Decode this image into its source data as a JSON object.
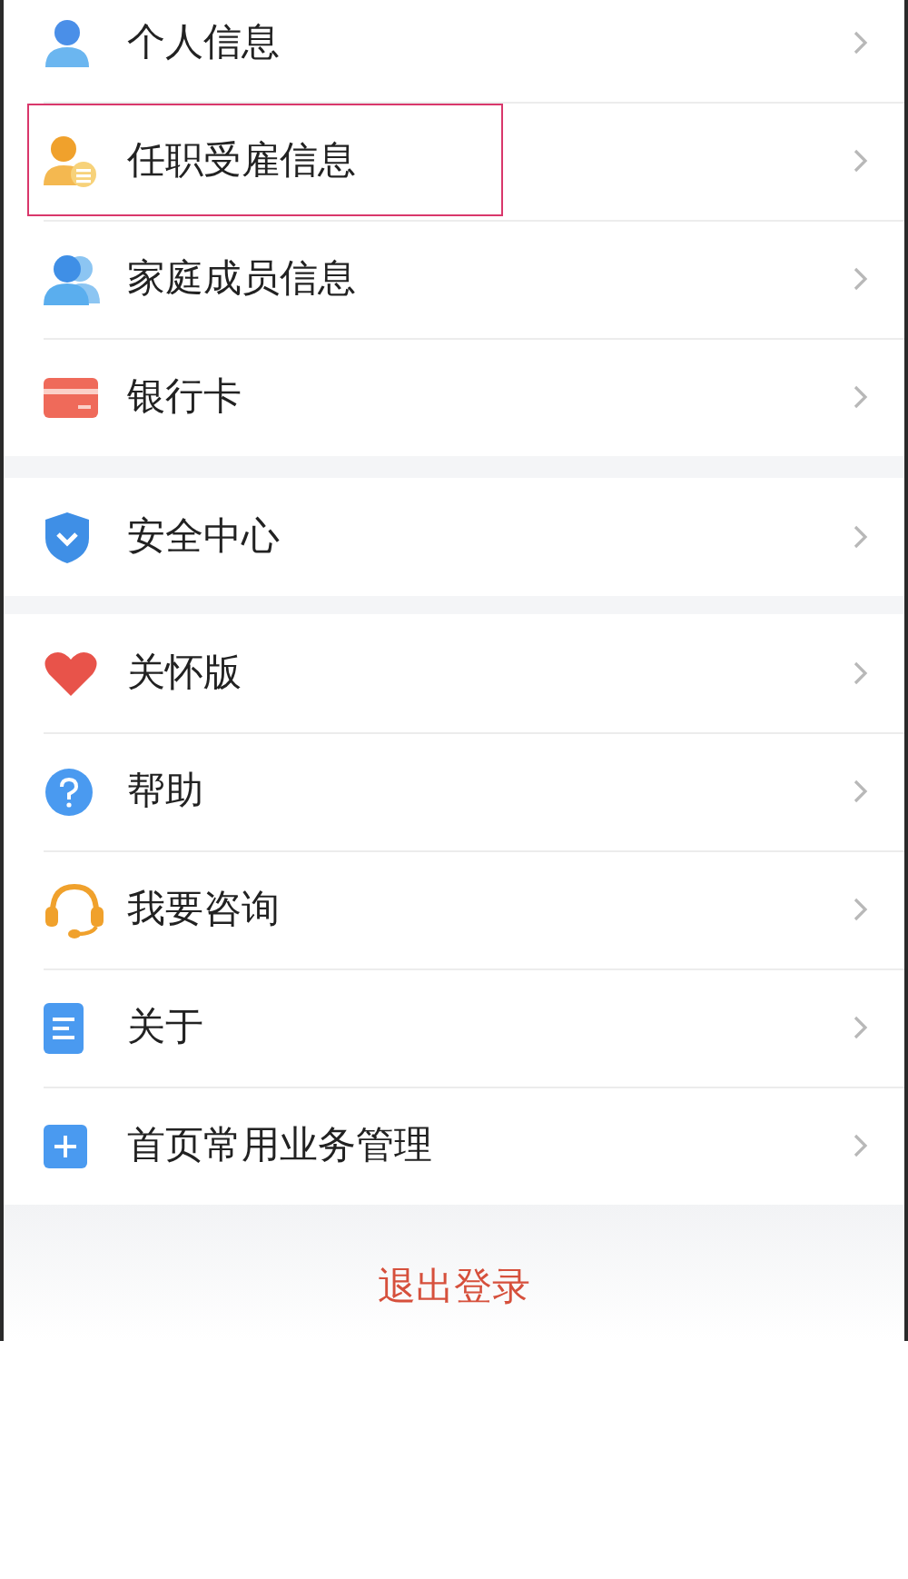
{
  "groups": [
    {
      "items": [
        {
          "label": "个人信息",
          "highlighted": false
        },
        {
          "label": "任职受雇信息",
          "highlighted": true
        },
        {
          "label": "家庭成员信息",
          "highlighted": false
        },
        {
          "label": "银行卡",
          "highlighted": false
        }
      ]
    },
    {
      "items": [
        {
          "label": "安全中心",
          "highlighted": false
        }
      ]
    },
    {
      "items": [
        {
          "label": "关怀版",
          "highlighted": false
        },
        {
          "label": "帮助",
          "highlighted": false
        },
        {
          "label": "我要咨询",
          "highlighted": false
        },
        {
          "label": "关于",
          "highlighted": false
        },
        {
          "label": "首页常用业务管理",
          "highlighted": false
        }
      ]
    }
  ],
  "logout_button": "退出登录"
}
